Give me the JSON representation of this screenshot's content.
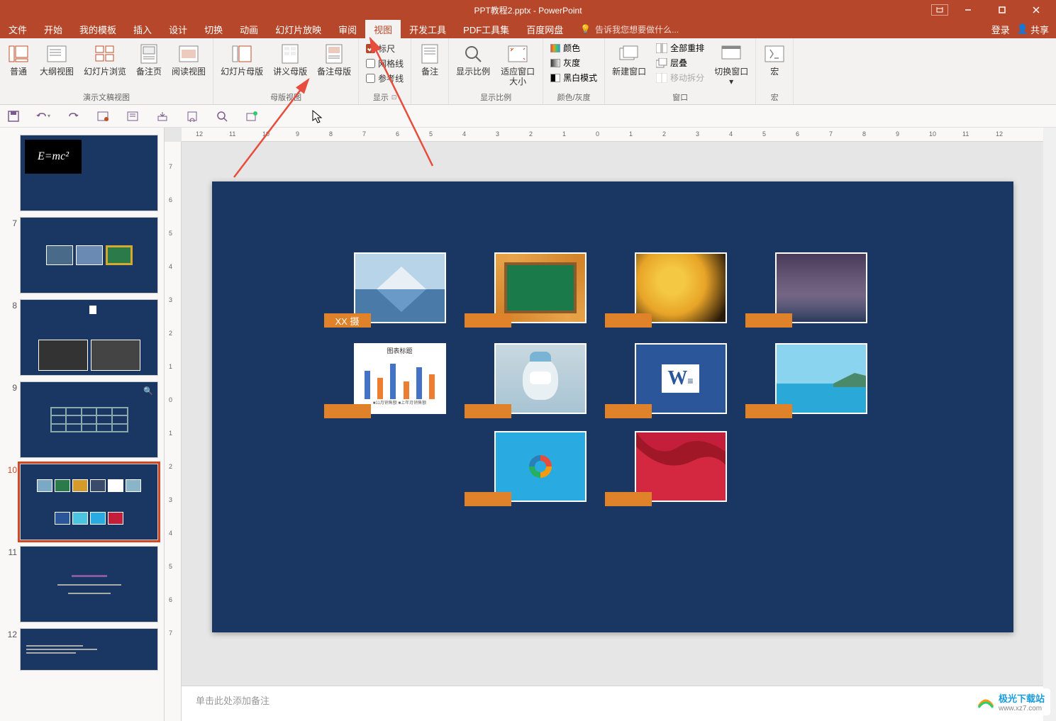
{
  "titlebar": {
    "filename": "PPT教程2.pptx - PowerPoint"
  },
  "menubar": {
    "tabs": [
      "文件",
      "开始",
      "我的模板",
      "插入",
      "设计",
      "切换",
      "动画",
      "幻灯片放映",
      "审阅",
      "视图",
      "开发工具",
      "PDF工具集",
      "百度网盘"
    ],
    "active_index": 9,
    "tell_me": "告诉我您想要做什么...",
    "login": "登录",
    "share": "共享"
  },
  "ribbon": {
    "views": {
      "normal": "普通",
      "outline": "大纲视图",
      "sorter": "幻灯片浏览",
      "notes_page": "备注页",
      "reading": "阅读视图",
      "group_label": "演示文稿视图"
    },
    "masters": {
      "slide_master": "幻灯片母版",
      "handout_master": "讲义母版",
      "notes_master": "备注母版",
      "group_label": "母版视图"
    },
    "show": {
      "ruler": "标尺",
      "gridlines": "网格线",
      "guides": "参考线",
      "group_label": "显示"
    },
    "notes": {
      "label": "备注"
    },
    "zoom": {
      "zoom": "显示比例",
      "fit": "适应窗口大小",
      "group_label": "显示比例"
    },
    "color": {
      "color": "颜色",
      "gray": "灰度",
      "bw": "黑白模式",
      "group_label": "颜色/灰度"
    },
    "window": {
      "new": "新建窗口",
      "arrange": "全部重排",
      "cascade": "层叠",
      "move_split": "移动拆分",
      "switch": "切换窗口",
      "group_label": "窗口"
    },
    "macros": {
      "label": "宏",
      "group_label": "宏"
    }
  },
  "slides": {
    "visible_start": 6,
    "items": [
      {
        "num": "",
        "type": "emc2"
      },
      {
        "num": "7",
        "type": "three-images"
      },
      {
        "num": "8",
        "type": "bw-photos"
      },
      {
        "num": "9",
        "type": "table"
      },
      {
        "num": "10",
        "type": "grid",
        "selected": true
      },
      {
        "num": "11",
        "type": "text-lines"
      },
      {
        "num": "12",
        "type": "bullets"
      }
    ]
  },
  "canvas": {
    "images": [
      {
        "row": 0,
        "col": 0,
        "label": "XX 摄",
        "bg": "#7ba8c4"
      },
      {
        "row": 0,
        "col": 1,
        "label": "",
        "bg": "#2a7a4a"
      },
      {
        "row": 0,
        "col": 2,
        "label": "",
        "bg": "#d49a2a"
      },
      {
        "row": 0,
        "col": 3,
        "label": "",
        "bg": "#3a4a6a"
      },
      {
        "row": 1,
        "col": 0,
        "label": "",
        "bg": "#ffffff",
        "chart": true
      },
      {
        "row": 1,
        "col": 1,
        "label": "",
        "bg": "#8ab4c8"
      },
      {
        "row": 1,
        "col": 2,
        "label": "",
        "bg": "#2b579a",
        "word": true
      },
      {
        "row": 1,
        "col": 3,
        "label": "",
        "bg": "#4ac4e0"
      },
      {
        "row": 2,
        "col": 1,
        "label": "",
        "bg": "#29abe2",
        "office": true
      },
      {
        "row": 2,
        "col": 2,
        "label": "",
        "bg": "#c41e3a",
        "flag": true
      }
    ],
    "chart_title": "图表标题"
  },
  "notes": {
    "placeholder": "单击此处添加备注"
  },
  "ruler": {
    "h_ticks": [
      "12",
      "11",
      "10",
      "9",
      "8",
      "7",
      "6",
      "5",
      "4",
      "3",
      "2",
      "1",
      "0",
      "1",
      "2",
      "3",
      "4",
      "5",
      "6",
      "7",
      "8",
      "9",
      "10",
      "11",
      "12"
    ],
    "v_ticks": [
      "7",
      "6",
      "5",
      "4",
      "3",
      "2",
      "1",
      "0",
      "1",
      "2",
      "3",
      "4",
      "5",
      "6",
      "7"
    ]
  },
  "watermark": {
    "text": "极光下载站",
    "url": "www.xz7.com"
  }
}
